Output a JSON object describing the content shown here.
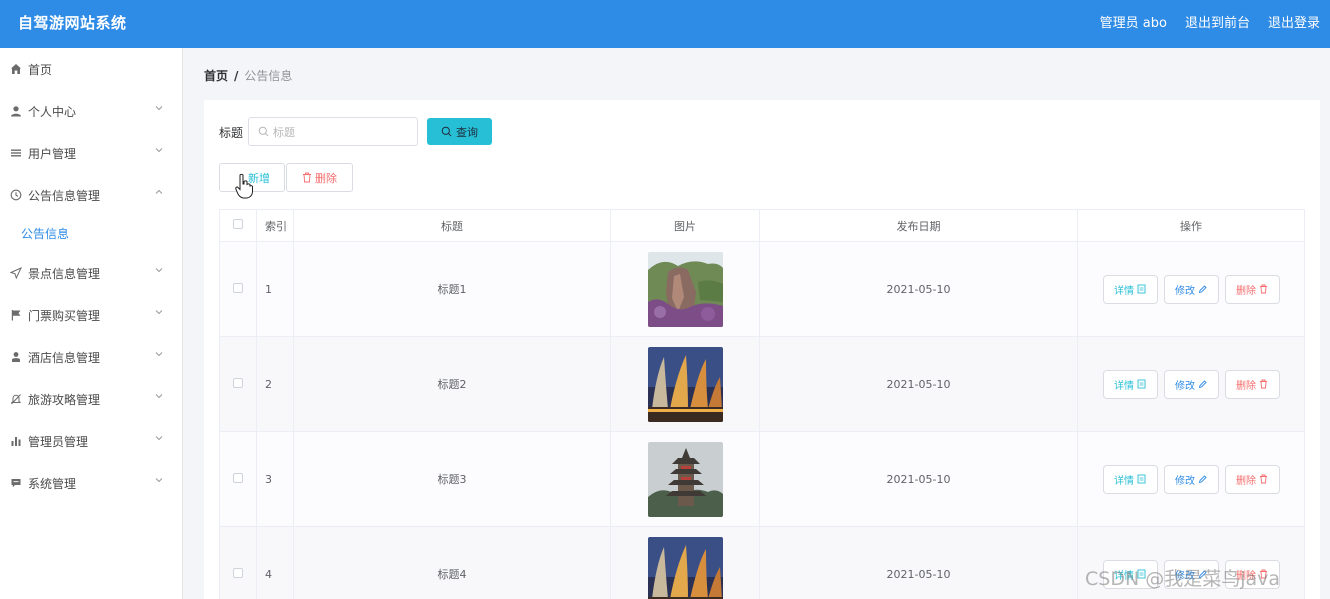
{
  "app": {
    "title": "自驾游网站系统"
  },
  "header": {
    "user_label": "管理员 abo",
    "front_link": "退出到前台",
    "logout_link": "退出登录"
  },
  "sidebar": {
    "items": [
      {
        "label": "首页",
        "icon": "home-icon"
      },
      {
        "label": "个人中心",
        "icon": "user-icon"
      },
      {
        "label": "用户管理",
        "icon": "list-icon"
      },
      {
        "label": "公告信息管理",
        "icon": "clock-icon",
        "expanded": true,
        "children": [
          {
            "label": "公告信息",
            "active": true
          }
        ]
      },
      {
        "label": "景点信息管理",
        "icon": "send-icon"
      },
      {
        "label": "门票购买管理",
        "icon": "flag-icon"
      },
      {
        "label": "酒店信息管理",
        "icon": "person-icon"
      },
      {
        "label": "旅游攻略管理",
        "icon": "bell-off-icon"
      },
      {
        "label": "管理员管理",
        "icon": "bar-chart-icon"
      },
      {
        "label": "系统管理",
        "icon": "chat-icon"
      }
    ]
  },
  "breadcrumb": {
    "home": "首页",
    "separator": "/",
    "current": "公告信息"
  },
  "search": {
    "label": "标题",
    "placeholder": "标题",
    "value": "",
    "button": "查询"
  },
  "toolbar": {
    "add": "新增",
    "delete": "删除"
  },
  "table": {
    "columns": [
      "",
      "索引",
      "标题",
      "图片",
      "发布日期",
      "操作"
    ],
    "rows": [
      {
        "index": "1",
        "title": "标题1",
        "image": "scenic-mountain-cliff",
        "date": "2021-05-10"
      },
      {
        "index": "2",
        "title": "标题2",
        "image": "opera-house-night",
        "date": "2021-05-10"
      },
      {
        "index": "3",
        "title": "标题3",
        "image": "pagoda-tower",
        "date": "2021-05-10"
      },
      {
        "index": "4",
        "title": "标题4",
        "image": "opera-house-night",
        "date": "2021-05-10"
      }
    ],
    "actions": {
      "detail": "详情",
      "edit": "修改",
      "delete": "删除"
    }
  },
  "watermark": "CSDN @我是菜鸟java",
  "colors": {
    "header": "#2e8be6",
    "accent": "#27bfd6",
    "danger": "#f56c6c"
  }
}
